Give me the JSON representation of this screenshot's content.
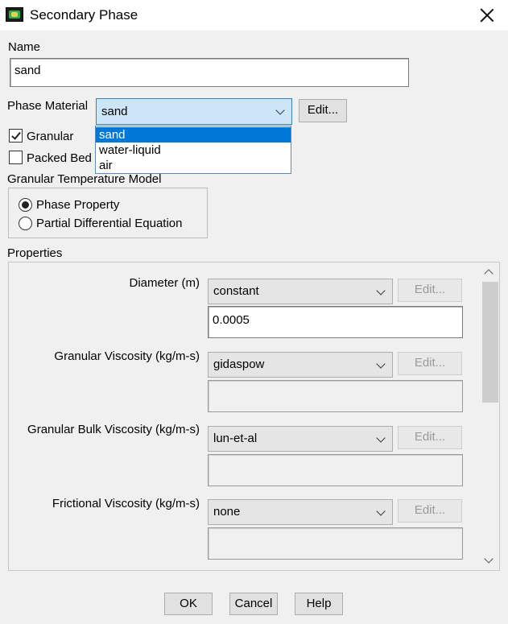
{
  "window": {
    "title": "Secondary Phase"
  },
  "name": {
    "label": "Name",
    "value": "sand"
  },
  "phase_material": {
    "label": "Phase Material",
    "selected": "sand",
    "edit_label": "Edit...",
    "options": [
      "sand",
      "water-liquid",
      "air"
    ]
  },
  "granular": {
    "label": "Granular",
    "checked": true
  },
  "packed_bed": {
    "label": "Packed Bed",
    "checked": false
  },
  "granular_temperature_model": {
    "label": "Granular Temperature Model",
    "options": [
      "Phase Property",
      "Partial Differential Equation"
    ],
    "selected": "Phase Property"
  },
  "properties": {
    "label": "Properties",
    "items": [
      {
        "label": "Diameter (m)",
        "method": "constant",
        "value": "0.0005",
        "edit_label": "Edit..."
      },
      {
        "label": "Granular Viscosity (kg/m-s)",
        "method": "gidaspow",
        "value": "",
        "edit_label": "Edit..."
      },
      {
        "label": "Granular Bulk Viscosity (kg/m-s)",
        "method": "lun-et-al",
        "value": "",
        "edit_label": "Edit..."
      },
      {
        "label": "Frictional Viscosity (kg/m-s)",
        "method": "none",
        "value": "",
        "edit_label": "Edit..."
      }
    ]
  },
  "buttons": {
    "ok": "OK",
    "cancel": "Cancel",
    "help": "Help"
  }
}
